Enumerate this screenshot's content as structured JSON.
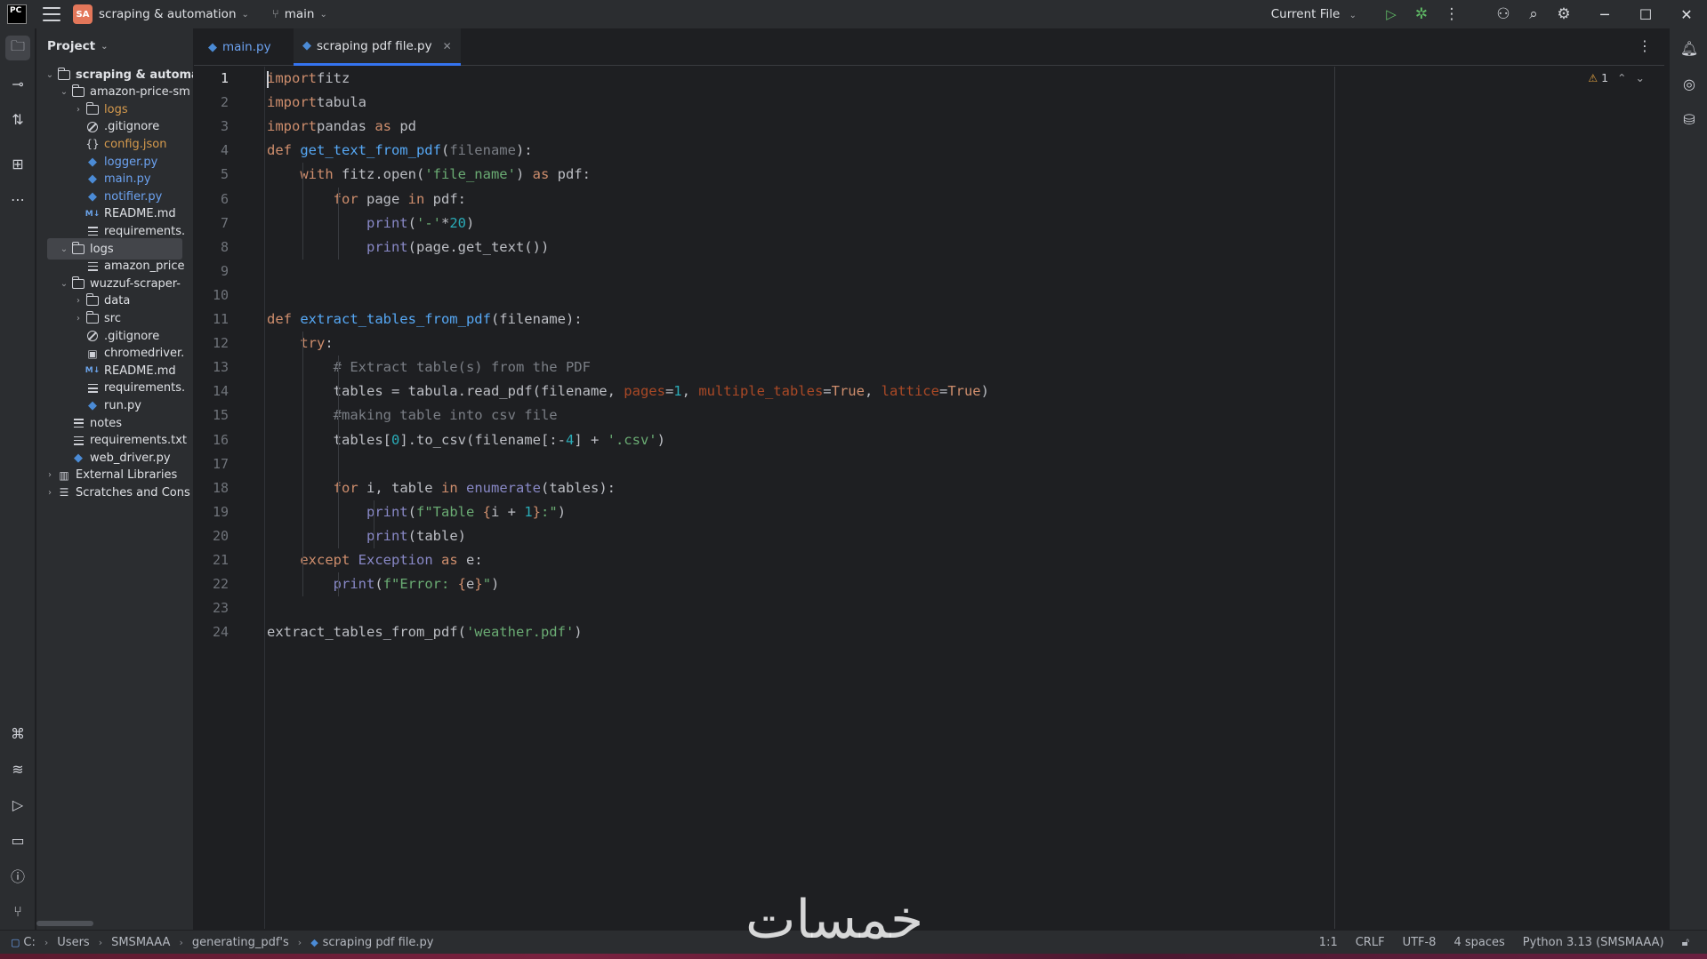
{
  "titlebar": {
    "logo_text": "PC",
    "project_badge": "SA",
    "project_name": "scraping & automation",
    "branch": "main",
    "run_config": "Current File"
  },
  "left_stripe": {
    "icons": [
      "folder-icon",
      "commit-icon",
      "pull-requests-icon",
      "structure-icon",
      "more-icon",
      "python-console-icon",
      "layers-icon",
      "run-icon",
      "terminal-icon",
      "problems-icon",
      "git-icon"
    ]
  },
  "project_panel": {
    "title": "Project",
    "tree": [
      {
        "label": "scraping & automati",
        "kind": "folder",
        "depth": 0,
        "expanded": true,
        "bold": true
      },
      {
        "label": "amazon-price-sm",
        "kind": "folder",
        "depth": 1,
        "expanded": true
      },
      {
        "label": "logs",
        "kind": "folder",
        "depth": 2,
        "expanded": false,
        "color": "orange"
      },
      {
        "label": ".gitignore",
        "kind": "ignore",
        "depth": 2
      },
      {
        "label": "config.json",
        "kind": "json",
        "depth": 2,
        "color": "orange"
      },
      {
        "label": "logger.py",
        "kind": "py",
        "depth": 2,
        "color": "blue"
      },
      {
        "label": "main.py",
        "kind": "py",
        "depth": 2,
        "color": "blue"
      },
      {
        "label": "notifier.py",
        "kind": "py",
        "depth": 2,
        "color": "blue"
      },
      {
        "label": "README.md",
        "kind": "md",
        "depth": 2
      },
      {
        "label": "requirements.",
        "kind": "text",
        "depth": 2
      },
      {
        "label": "logs",
        "kind": "folder",
        "depth": 1,
        "expanded": true,
        "selected": true
      },
      {
        "label": "amazon_price",
        "kind": "text",
        "depth": 2
      },
      {
        "label": "wuzzuf-scraper-",
        "kind": "folder",
        "depth": 1,
        "expanded": true
      },
      {
        "label": "data",
        "kind": "folder",
        "depth": 2,
        "expanded": false
      },
      {
        "label": "src",
        "kind": "folder",
        "depth": 2,
        "expanded": false
      },
      {
        "label": ".gitignore",
        "kind": "ignore",
        "depth": 2
      },
      {
        "label": "chromedriver.",
        "kind": "binary",
        "depth": 2
      },
      {
        "label": "README.md",
        "kind": "md",
        "depth": 2
      },
      {
        "label": "requirements.",
        "kind": "text",
        "depth": 2
      },
      {
        "label": "run.py",
        "kind": "py",
        "depth": 2
      },
      {
        "label": "notes",
        "kind": "text",
        "depth": 1
      },
      {
        "label": "requirements.txt",
        "kind": "text",
        "depth": 1
      },
      {
        "label": "web_driver.py",
        "kind": "py",
        "depth": 1
      },
      {
        "label": "External Libraries",
        "kind": "library",
        "depth": 0,
        "expanded": false
      },
      {
        "label": "Scratches and Cons",
        "kind": "scratch",
        "depth": 0,
        "expanded": false
      }
    ]
  },
  "tabs": [
    {
      "label": "main.py",
      "active": false
    },
    {
      "label": "scraping pdf file.py",
      "active": true
    }
  ],
  "editor": {
    "warning_count": "1",
    "lines": [
      [
        [
          "kw",
          "import"
        ],
        [
          "",
          "fitz"
        ]
      ],
      [
        [
          "kw",
          "import"
        ],
        [
          "",
          "tabula"
        ]
      ],
      [
        [
          "kw",
          "import"
        ],
        [
          "",
          "pandas "
        ],
        [
          "kw",
          "as"
        ],
        [
          "",
          " pd"
        ]
      ],
      [
        [
          "kw",
          "def "
        ],
        [
          "fn",
          "get_text_from_pdf"
        ],
        [
          "",
          "("
        ],
        [
          "param",
          "filename"
        ],
        [
          "",
          "):"
        ]
      ],
      [
        [
          "",
          "    "
        ],
        [
          "kw",
          "with"
        ],
        [
          "",
          " fitz.open("
        ],
        [
          "str",
          "'file_name'"
        ],
        [
          "",
          ") "
        ],
        [
          "kw",
          "as"
        ],
        [
          "",
          " pdf:"
        ]
      ],
      [
        [
          "",
          "        "
        ],
        [
          "kw",
          "for"
        ],
        [
          "",
          " page "
        ],
        [
          "kw",
          "in"
        ],
        [
          "",
          " pdf:"
        ]
      ],
      [
        [
          "",
          "            "
        ],
        [
          "bi",
          "print"
        ],
        [
          "",
          "("
        ],
        [
          "str",
          "'-'"
        ],
        [
          "",
          "*"
        ],
        [
          "num",
          "20"
        ],
        [
          "",
          ")"
        ]
      ],
      [
        [
          "",
          "            "
        ],
        [
          "bi",
          "print"
        ],
        [
          "",
          "(page.get_text())"
        ]
      ],
      [],
      [],
      [
        [
          "kw",
          "def "
        ],
        [
          "fn",
          "extract_tables_from_pdf"
        ],
        [
          "",
          "(filename):"
        ]
      ],
      [
        [
          "",
          "    "
        ],
        [
          "kw",
          "try"
        ],
        [
          "",
          ":"
        ]
      ],
      [
        [
          "",
          "        "
        ],
        [
          "cmt",
          "# Extract table(s) from the PDF"
        ]
      ],
      [
        [
          "",
          "        tables = tabula.read_pdf(filename, "
        ],
        [
          "kwarg",
          "pages"
        ],
        [
          "",
          "="
        ],
        [
          "num",
          "1"
        ],
        [
          "",
          ", "
        ],
        [
          "kwarg",
          "multiple_tables"
        ],
        [
          "",
          "="
        ],
        [
          "kw",
          "True"
        ],
        [
          "",
          ", "
        ],
        [
          "kwarg",
          "lattice"
        ],
        [
          "",
          "="
        ],
        [
          "kw",
          "True"
        ],
        [
          "",
          ")"
        ]
      ],
      [
        [
          "",
          "        "
        ],
        [
          "cmt",
          "#making table into csv file"
        ]
      ],
      [
        [
          "",
          "        tables["
        ],
        [
          "num",
          "0"
        ],
        [
          "",
          "].to_csv(filename[:-"
        ],
        [
          "num",
          "4"
        ],
        [
          "",
          "] + "
        ],
        [
          "str",
          "'.csv'"
        ],
        [
          "",
          ")"
        ]
      ],
      [],
      [
        [
          "",
          "        "
        ],
        [
          "kw",
          "for"
        ],
        [
          "",
          " i, table "
        ],
        [
          "kw",
          "in"
        ],
        [
          "",
          " "
        ],
        [
          "bi",
          "enumerate"
        ],
        [
          "",
          "(tables):"
        ]
      ],
      [
        [
          "",
          "            "
        ],
        [
          "bi",
          "print"
        ],
        [
          "",
          "("
        ],
        [
          "str",
          "f\"Table "
        ],
        [
          "kw",
          "{"
        ],
        [
          "",
          "i + "
        ],
        [
          "num",
          "1"
        ],
        [
          "kw",
          "}"
        ],
        [
          "str",
          ":\""
        ],
        [
          "",
          ")"
        ]
      ],
      [
        [
          "",
          "            "
        ],
        [
          "bi",
          "print"
        ],
        [
          "",
          "(table)"
        ]
      ],
      [
        [
          "",
          "    "
        ],
        [
          "kw",
          "except"
        ],
        [
          "",
          " "
        ],
        [
          "bi",
          "Exception"
        ],
        [
          "",
          " "
        ],
        [
          "kw",
          "as"
        ],
        [
          "",
          " e:"
        ]
      ],
      [
        [
          "",
          "        "
        ],
        [
          "bi",
          "print"
        ],
        [
          "",
          "("
        ],
        [
          "str",
          "f\"Error: "
        ],
        [
          "kw",
          "{"
        ],
        [
          "",
          "e"
        ],
        [
          "kw",
          "}"
        ],
        [
          "str",
          "\""
        ],
        [
          "",
          ")"
        ]
      ],
      [],
      [
        [
          "",
          "extract_tables_from_pdf("
        ],
        [
          "str",
          "'weather.pdf'"
        ],
        [
          "",
          ")"
        ]
      ]
    ]
  },
  "right_stripe": {
    "icons": [
      "notifications-icon",
      "ai-assistant-icon",
      "database-icon"
    ]
  },
  "statusbar": {
    "breadcrumbs": [
      "C:",
      "Users",
      "SMSMAAA",
      "generating_pdf's",
      "scraping pdf file.py"
    ],
    "position": "1:1",
    "line_ending": "CRLF",
    "encoding": "UTF-8",
    "indent": "4 spaces",
    "interpreter": "Python 3.13 (SMSMAAA)"
  },
  "watermark": {
    "text": "خمسات"
  }
}
